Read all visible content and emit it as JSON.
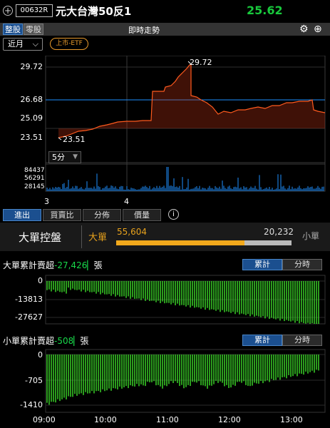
{
  "header": {
    "add_icon": "plus-circle-icon",
    "code": "00632R",
    "name": "元大台灣50反1",
    "price": "25.62"
  },
  "toolbar": {
    "seg_whole": "整股",
    "seg_odd": "零股",
    "title": "即時走勢",
    "settings_icon": "gear-icon",
    "add_icon": "plus-circle-icon",
    "period": "近月",
    "badge": "上市-ETF"
  },
  "price_chart": {
    "y_ticks": [
      "29.72",
      "26.68",
      "25.09",
      "23.51"
    ],
    "high_label": "29.72",
    "low_label": "23.51",
    "ma_select": "5分",
    "vol_ticks": [
      "84437",
      "56291",
      "28145"
    ],
    "x_ticks": [
      "3",
      "4"
    ]
  },
  "tabs": [
    "進出",
    "買賣比",
    "分佈",
    "價量"
  ],
  "big_order": {
    "title": "大單控盤",
    "big_label": "大單",
    "big_value": "55,604",
    "small_value": "20,232",
    "small_label": "小單",
    "big_share": 0.733
  },
  "big_cum": {
    "label": "大單累計賣超",
    "value": "-27,426",
    "unit": "張",
    "toggle_cum": "累計",
    "toggle_time": "分時",
    "y_ticks": [
      "0",
      "-13813",
      "-27627"
    ]
  },
  "small_cum": {
    "label": "小單累計賣超",
    "value": "-508",
    "unit": "張",
    "toggle_cum": "累計",
    "toggle_time": "分時",
    "y_ticks": [
      "0",
      "-705",
      "-1410"
    ]
  },
  "time_axis": [
    "09:00",
    "10:00",
    "11:00",
    "12:00",
    "13:00"
  ],
  "colors": {
    "up": "#18c93c",
    "line": "#ff5a1e",
    "ref": "#1e90ff",
    "bar": "#3ee02a",
    "accent": "#f2a91c"
  }
}
